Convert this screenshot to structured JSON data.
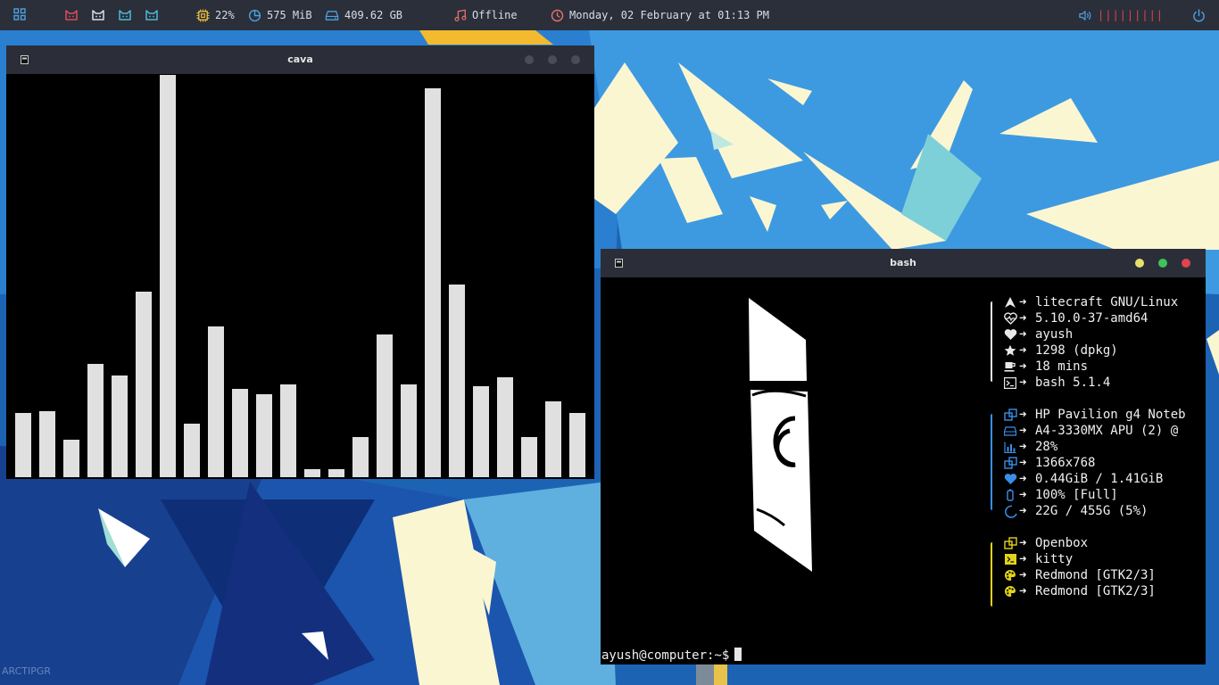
{
  "topbar": {
    "cpu": "22%",
    "memory": "575 MiB",
    "disk": "409.62 GB",
    "music_status": "Offline",
    "datetime": "Monday, 02 February at 01:13 PM",
    "volume_bars": "|||||||||"
  },
  "cava_window": {
    "title": "cava",
    "levels": [
      0.159,
      0.163,
      0.093,
      0.28,
      0.253,
      0.46,
      0.998,
      0.133,
      0.373,
      0.22,
      0.205,
      0.23,
      0.02,
      0.02,
      0.1,
      0.355,
      0.23,
      0.965,
      0.478,
      0.225,
      0.248,
      0.1,
      0.187,
      0.16
    ]
  },
  "bash_window": {
    "title": "bash",
    "info_group_1": [
      "litecraft GNU/Linux",
      " 5.10.0-37-amd64",
      " ayush",
      " 1298 (dpkg)",
      "18 mins",
      "bash 5.1.4"
    ],
    "info_group_2": [
      "HP Pavilion g4 Noteb",
      "A4-3330MX APU (2) @",
      "28%",
      "1366x768",
      " 0.44GiB / 1.41GiB",
      "100% [Full]",
      "22G / 455G (5%)"
    ],
    "info_group_3": [
      "Openbox",
      "kitty",
      "Redmond [GTK2/3]",
      "Redmond [GTK2/3]"
    ],
    "prompt": "ayush@computer:~$"
  },
  "colors": {
    "topbar_bg": "#2a2f3a",
    "group1": "#e8e8e8",
    "group2": "#3a8ee6",
    "group3": "#e2d21b",
    "close": "#e0444d",
    "maximize": "#3ec45a",
    "minimize": "#e8e06a"
  },
  "watermark": "ARCTIPGR"
}
